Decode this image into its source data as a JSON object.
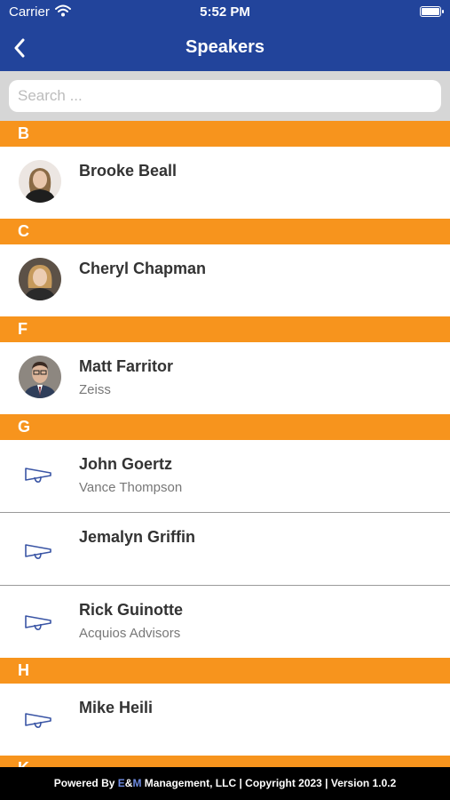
{
  "status_bar": {
    "carrier": "Carrier",
    "time": "5:52 PM"
  },
  "nav": {
    "title": "Speakers"
  },
  "search": {
    "placeholder": "Search ..."
  },
  "sections": [
    {
      "letter": "B",
      "speakers": [
        {
          "name": "Brooke Beall",
          "company": "",
          "icon": "photo"
        }
      ]
    },
    {
      "letter": "C",
      "speakers": [
        {
          "name": "Cheryl Chapman",
          "company": "",
          "icon": "photo"
        }
      ]
    },
    {
      "letter": "F",
      "speakers": [
        {
          "name": "Matt Farritor",
          "company": "Zeiss",
          "icon": "photo"
        }
      ]
    },
    {
      "letter": "G",
      "speakers": [
        {
          "name": "John Goertz",
          "company": "Vance Thompson",
          "icon": "megaphone-icon"
        },
        {
          "name": "Jemalyn Griffin",
          "company": "",
          "icon": "megaphone-icon"
        },
        {
          "name": "Rick Guinotte",
          "company": "Acquios Advisors",
          "icon": "megaphone-icon"
        }
      ]
    },
    {
      "letter": "H",
      "speakers": [
        {
          "name": "Mike Heili",
          "company": "",
          "icon": "megaphone-icon"
        }
      ]
    },
    {
      "letter": "K",
      "speakers": []
    }
  ],
  "footer": {
    "prefix": "Powered By ",
    "brand_e": "E",
    "brand_amp": "&",
    "brand_m": "M",
    "suffix": " Management, LLC | Copyright 2023 | Version 1.0.2"
  },
  "colors": {
    "nav": "#22449b",
    "section_header": "#f7941d",
    "footer": "#000000"
  }
}
